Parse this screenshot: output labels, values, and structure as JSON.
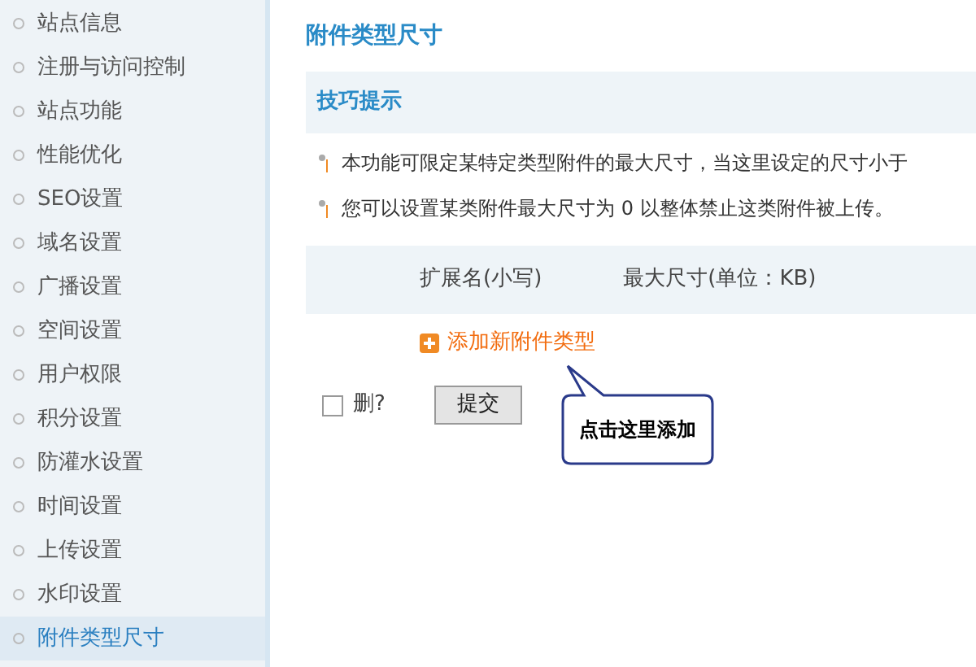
{
  "sidebar": {
    "items": [
      {
        "label": "站点信息",
        "selected": false
      },
      {
        "label": "注册与访问控制",
        "selected": false
      },
      {
        "label": "站点功能",
        "selected": false
      },
      {
        "label": "性能优化",
        "selected": false
      },
      {
        "label": "SEO设置",
        "selected": false
      },
      {
        "label": "域名设置",
        "selected": false
      },
      {
        "label": "广播设置",
        "selected": false
      },
      {
        "label": "空间设置",
        "selected": false
      },
      {
        "label": "用户权限",
        "selected": false
      },
      {
        "label": "积分设置",
        "selected": false
      },
      {
        "label": "防灌水设置",
        "selected": false
      },
      {
        "label": "时间设置",
        "selected": false
      },
      {
        "label": "上传设置",
        "selected": false
      },
      {
        "label": "水印设置",
        "selected": false
      },
      {
        "label": "附件类型尺寸",
        "selected": true
      }
    ]
  },
  "main": {
    "title": "附件类型尺寸",
    "tips": {
      "title": "技巧提示",
      "items": [
        "本功能可限定某特定类型附件的最大尺寸，当这里设定的尺寸小于",
        "您可以设置某类附件最大尺寸为 0 以整体禁止这类附件被上传。"
      ]
    },
    "table": {
      "columns": [
        "扩展名(小写)",
        "最大尺寸(单位：KB)"
      ]
    },
    "add_link": "添加新附件类型",
    "delete_checkbox": {
      "label": "删?",
      "checked": false
    },
    "submit_button": "提交",
    "callout": "点击这里添加"
  }
}
